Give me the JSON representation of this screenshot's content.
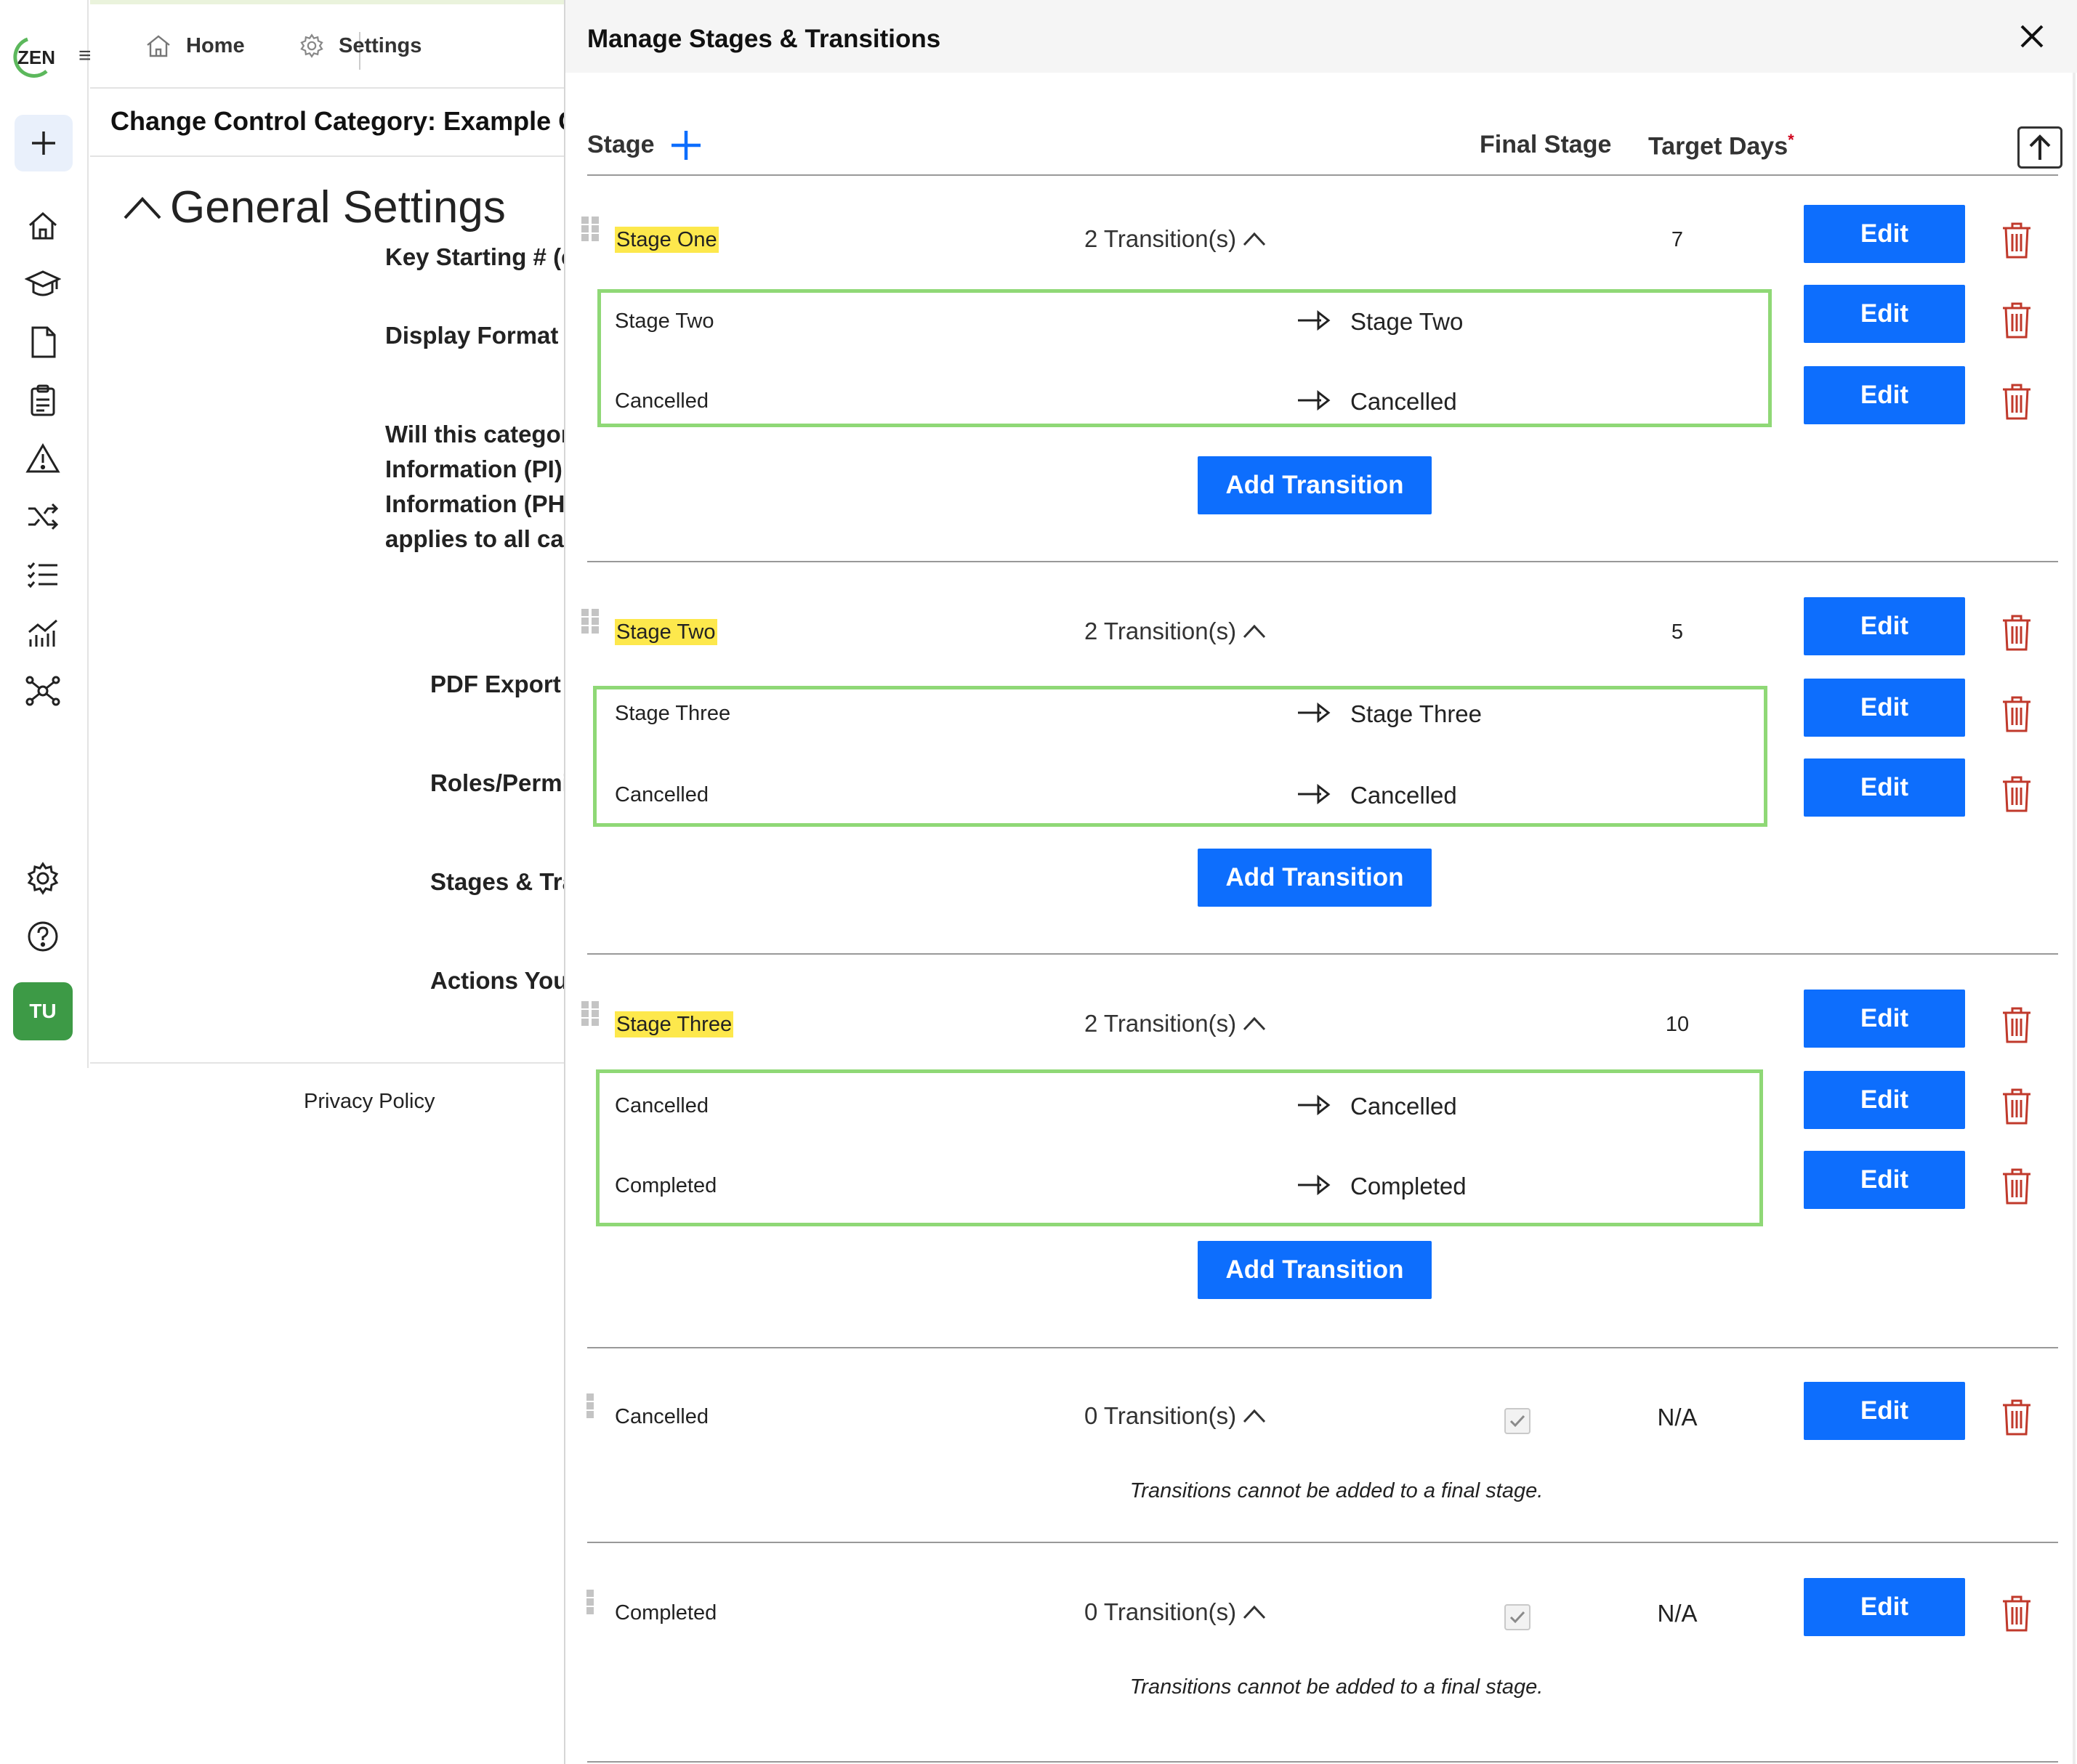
{
  "app": {
    "logo_text": "ZEN"
  },
  "rail": {
    "avatar_initials": "TU"
  },
  "breadcrumb": {
    "home": "Home",
    "settings": "Settings"
  },
  "page": {
    "title": "Change Control Category: Example Cha",
    "section_title": "General Settings",
    "labels": {
      "key_starting": "Key Starting # (e",
      "display_format": "Display Format",
      "pi_line1": "Will this categor",
      "pi_line2": "Information (PI)",
      "pi_line3": "Information (PH",
      "pi_line4": "applies to all cate",
      "pdf_export": "PDF Export (",
      "roles": "Roles/Permi",
      "stages": "Stages & Tra",
      "actions": "Actions You"
    },
    "footer": {
      "privacy": "Privacy Policy"
    }
  },
  "modal": {
    "title": "Manage Stages & Transitions",
    "columns": {
      "stage": "Stage",
      "final_stage": "Final Stage",
      "target_days": "Target Days",
      "required_mark": "*"
    },
    "edit_label": "Edit",
    "add_transition_label": "Add Transition",
    "final_note": "Transitions cannot be added to a final stage.",
    "stages": [
      {
        "name": "Stage One",
        "transitions_label": "2 Transition(s)",
        "days": "7",
        "transitions": [
          {
            "from": "Stage Two",
            "to": "Stage Two"
          },
          {
            "from": "Cancelled",
            "to": "Cancelled"
          }
        ]
      },
      {
        "name": "Stage Two",
        "transitions_label": "2 Transition(s)",
        "days": "5",
        "transitions": [
          {
            "from": "Stage Three",
            "to": "Stage Three"
          },
          {
            "from": "Cancelled",
            "to": "Cancelled"
          }
        ]
      },
      {
        "name": "Stage Three",
        "transitions_label": "2 Transition(s)",
        "days": "10",
        "transitions": [
          {
            "from": "Cancelled",
            "to": "Cancelled"
          },
          {
            "from": "Completed",
            "to": "Completed"
          }
        ]
      },
      {
        "name": "Cancelled",
        "transitions_label": "0 Transition(s)",
        "days": "N/A",
        "final": true
      },
      {
        "name": "Completed",
        "transitions_label": "0 Transition(s)",
        "days": "N/A",
        "final": true
      }
    ]
  },
  "colors": {
    "primary": "#0d6efd",
    "highlight": "#fde84c",
    "transition_border": "#8fd876",
    "trash": "#c0392b",
    "avatar": "#3d9a46"
  }
}
